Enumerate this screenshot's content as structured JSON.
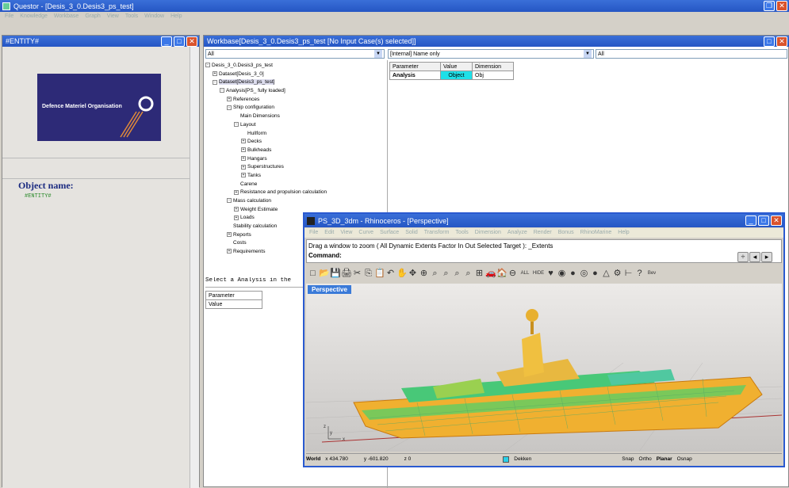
{
  "app": {
    "title": "Questor - [Desis_3_0.Desis3_ps_test]",
    "menu": [
      "File",
      "Knowledge",
      "Workbase",
      "Graph",
      "View",
      "Tools",
      "Window",
      "Help"
    ]
  },
  "entity": {
    "title": "#ENTITY#",
    "logo_text": "Defence Materiel Organisation",
    "object_label": "Object name:",
    "object_value": "#ENTITY#"
  },
  "workbase": {
    "title": "Workbase[Desis_3_0.Desis3_ps_test  [No Input Case(s) selected]]",
    "filter_left": "All",
    "filter_mid": "[Internal] Name only",
    "filter_right": "All",
    "tree": [
      {
        "label": "Desis_3_0.Desis3_ps_test",
        "indent": 0,
        "pm": "-"
      },
      {
        "label": "Dataset[Desis_3_0]",
        "indent": 1,
        "pm": "+"
      },
      {
        "label": "Dataset[Desis3_ps_test]",
        "indent": 1,
        "pm": "-",
        "sel": true
      },
      {
        "label": "Analysis[PS_ fully loaded]",
        "indent": 2,
        "pm": "-"
      },
      {
        "label": "References",
        "indent": 3,
        "pm": "+"
      },
      {
        "label": "Ship configuration",
        "indent": 3,
        "pm": "-"
      },
      {
        "label": "Main Dimensions",
        "indent": 4,
        "pm": ""
      },
      {
        "label": "Layout",
        "indent": 4,
        "pm": "-"
      },
      {
        "label": "Hullform",
        "indent": 5,
        "pm": ""
      },
      {
        "label": "Decks",
        "indent": 5,
        "pm": "+"
      },
      {
        "label": "Bulkheads",
        "indent": 5,
        "pm": "+"
      },
      {
        "label": "Hangars",
        "indent": 5,
        "pm": "+"
      },
      {
        "label": "Superstructures",
        "indent": 5,
        "pm": "+"
      },
      {
        "label": "Tanks",
        "indent": 5,
        "pm": "+"
      },
      {
        "label": "Carene",
        "indent": 4,
        "pm": ""
      },
      {
        "label": "Resistance and propulsion calculation",
        "indent": 4,
        "pm": "+"
      },
      {
        "label": "Mass calculation",
        "indent": 3,
        "pm": "-"
      },
      {
        "label": "Weight Estimate",
        "indent": 4,
        "pm": "+"
      },
      {
        "label": "Loads",
        "indent": 4,
        "pm": "+"
      },
      {
        "label": "Stability calculation",
        "indent": 3,
        "pm": ""
      },
      {
        "label": "Reports",
        "indent": 3,
        "pm": "+"
      },
      {
        "label": "Costs",
        "indent": 3,
        "pm": ""
      },
      {
        "label": "Requirements",
        "indent": 3,
        "pm": "+"
      }
    ],
    "grid_headers": [
      "Parameter",
      "Value",
      "Dimension"
    ],
    "grid_row": {
      "param": "Analysis",
      "value": "Object",
      "dim": "Obj"
    },
    "hint": "Select a Analysis in the",
    "lower_params": [
      "Parameter",
      "Value"
    ]
  },
  "rhino": {
    "title": "PS_3D_3dm - Rhinoceros - [Perspective]",
    "menu": [
      "File",
      "Edit",
      "View",
      "Curve",
      "Surface",
      "Solid",
      "Transform",
      "Tools",
      "Dimension",
      "Analyze",
      "Render",
      "Bonus",
      "RhinoMarine",
      "Help"
    ],
    "prompt": "Drag a window to zoom ( All  Dynamic  Extents  Factor  In  Out  Selected  Target ): _Extents",
    "command_label": "Command:",
    "viewport_tab": "Perspective",
    "status": {
      "world": "World",
      "x": "x 434.780",
      "y": "y -601.820",
      "z": "z 0",
      "layer": "Dekken",
      "snap": "Snap",
      "ortho": "Ortho",
      "planar": "Planar",
      "osnap": "Osnap"
    },
    "toolbar_icons": [
      "□",
      "📂",
      "💾",
      "🖨",
      "✂",
      "⎘",
      "📋",
      "↶",
      "✋",
      "✥",
      "⊕",
      "⌕",
      "⌕",
      "⌕",
      "⌕",
      "⊞",
      "🚗",
      "🏠",
      "⊖",
      "ALL",
      "HIDE",
      "♥",
      "◉",
      "●",
      "◎",
      "●",
      "△",
      "⚙",
      "⊢",
      "?",
      "Bev"
    ]
  }
}
